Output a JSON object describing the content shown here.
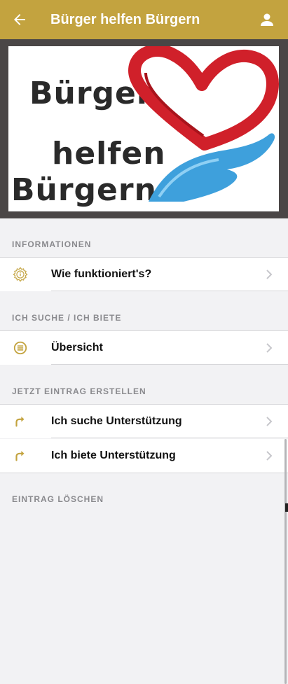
{
  "appbar": {
    "title": "Bürger helfen Bürgern",
    "back_icon": "arrow-left-icon",
    "user_icon": "person-icon",
    "color": "#c3a33f"
  },
  "logo": {
    "line1": "Bürger",
    "line2": "helfen",
    "line3": "Bürgern",
    "heart_color": "#d0202a",
    "hand_color": "#3ea0dc"
  },
  "sections": [
    {
      "title": "INFORMATIONEN",
      "items": [
        {
          "label": "Wie funktioniert's?",
          "icon": "info-badge-icon"
        }
      ]
    },
    {
      "title": "ICH SUCHE / ICH BIETE",
      "items": [
        {
          "label": "Übersicht",
          "icon": "list-icon"
        }
      ]
    },
    {
      "title": "JETZT EINTRAG ERSTELLEN",
      "items": [
        {
          "label": "Ich suche Unterstützung",
          "icon": "share-arrow-icon"
        },
        {
          "label": "Ich biete Unterstützung",
          "icon": "share-arrow-icon"
        }
      ]
    },
    {
      "title": "EINTRAG LÖSCHEN",
      "items": []
    }
  ],
  "accent_color": "#c3a33f"
}
